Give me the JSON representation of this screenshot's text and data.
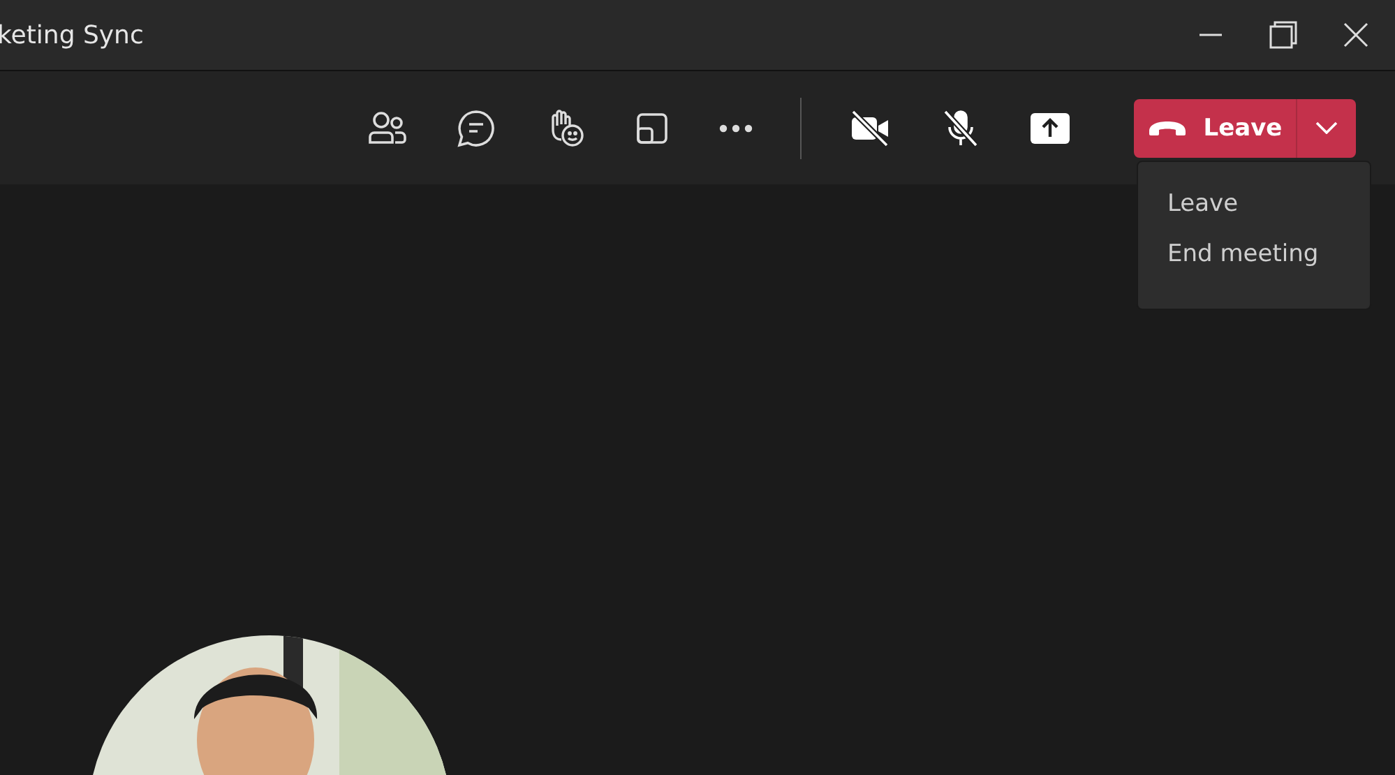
{
  "window": {
    "title": "keting Sync"
  },
  "toolbar": {
    "buttons": [
      {
        "kind": "people"
      },
      {
        "kind": "chat"
      },
      {
        "kind": "reactions"
      },
      {
        "kind": "rooms"
      },
      {
        "kind": "more"
      }
    ],
    "devices": [
      {
        "kind": "camera",
        "on": false
      },
      {
        "kind": "mic",
        "on": false
      },
      {
        "kind": "share"
      }
    ],
    "leave_button": {
      "label": "Leave",
      "expanded": true
    }
  },
  "leave_menu": {
    "items": [
      "Leave",
      "End meeting"
    ]
  }
}
